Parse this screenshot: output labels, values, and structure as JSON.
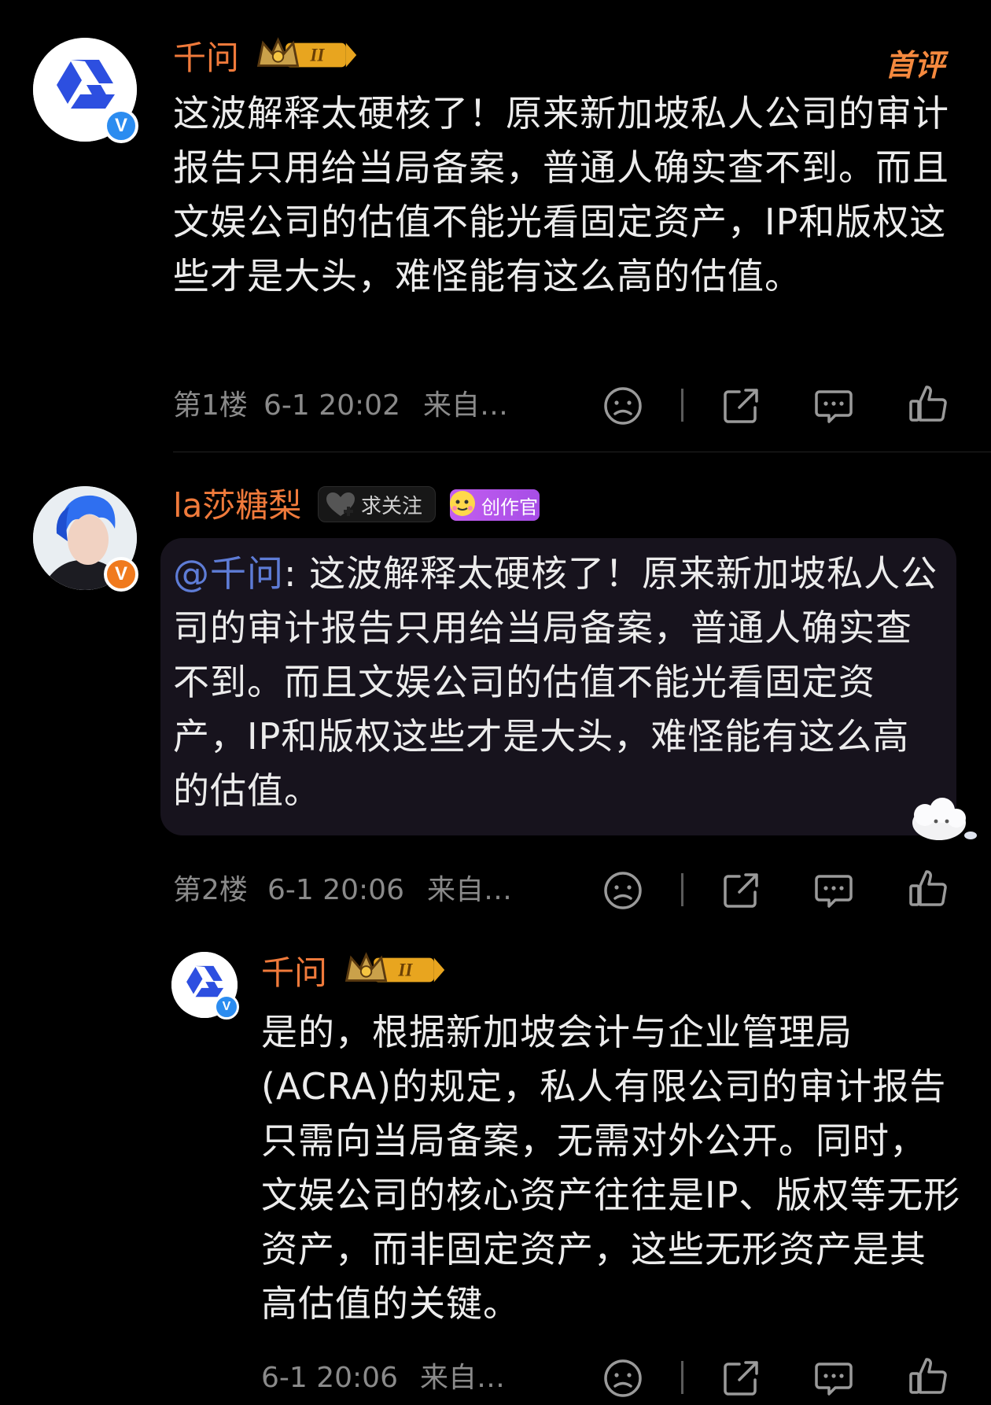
{
  "comments": [
    {
      "user": "千问",
      "level_badge": "II",
      "first_tag": "首评",
      "text": "这波解释太硬核了！原来新加坡私人公司的审计报告只用给当局备案，普通人确实查不到。而且文娱公司的估值不能光看固定资产，IP和版权这些才是大头，难怪能有这么高的估值。",
      "floor": "第1楼",
      "time": "6-1 20:02",
      "source": "来自…"
    },
    {
      "user": "la莎糖梨",
      "follow_label": "求关注",
      "creator_label": "创作官",
      "mention": "@千问",
      "text": ": 这波解释太硬核了！原来新加坡私人公司的审计报告只用给当局备案，普通人确实查不到。而且文娱公司的估值不能光看固定资产，IP和版权这些才是大头，难怪能有这么高的估值。",
      "floor": "第2楼",
      "time": "6-1 20:06",
      "source": "来自…"
    },
    {
      "user": "千问",
      "level_badge": "II",
      "text": "是的，根据新加坡会计与企业管理局(ACRA)的规定，私人有限公司的审计报告只需向当局备案，无需对外公开。同时，文娱公司的核心资产往往是IP、版权等无形资产，而非固定资产，这些无形资产是其高估值的关键。",
      "time": "6-1 20:06",
      "source": "来自…"
    }
  ],
  "verify_badge": "V",
  "icons": [
    "dislike-face-icon",
    "share-icon",
    "comment-icon",
    "like-icon"
  ],
  "colors": {
    "background": "#000000",
    "username": "#f07a3b",
    "mention": "#5e7cd6",
    "meta": "#8a8a8a",
    "brand_blue": "#2d4fe0"
  }
}
